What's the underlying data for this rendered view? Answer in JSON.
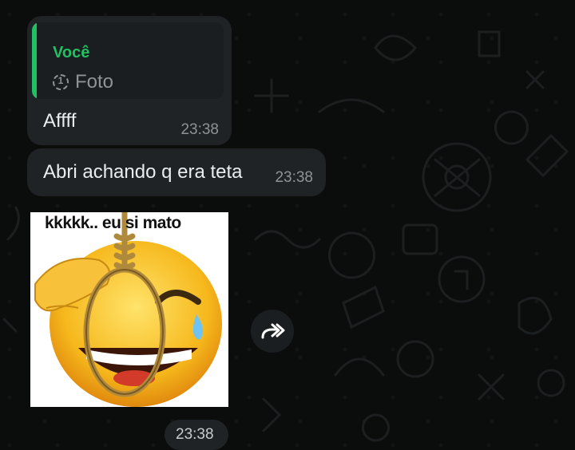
{
  "messages": [
    {
      "reply": {
        "author": "Você",
        "icon": "view-once-icon",
        "icon_glyph": "1",
        "text": "Foto"
      },
      "text": "Affff",
      "time": "23:38"
    },
    {
      "text": "Abri achando q era teta",
      "time": "23:38"
    },
    {
      "sticker": {
        "caption": "kkkkk.. eu si mato",
        "icon": "crying-laughing-emoji-with-noose"
      },
      "time": "23:38"
    }
  ],
  "actions": {
    "forward_icon": "forward-double-arrow-icon"
  },
  "colors": {
    "background": "#0b0c0c",
    "bubble": "#1f2326",
    "accent": "#21c063",
    "muted_text": "#8e9396",
    "text": "#e9edef"
  }
}
